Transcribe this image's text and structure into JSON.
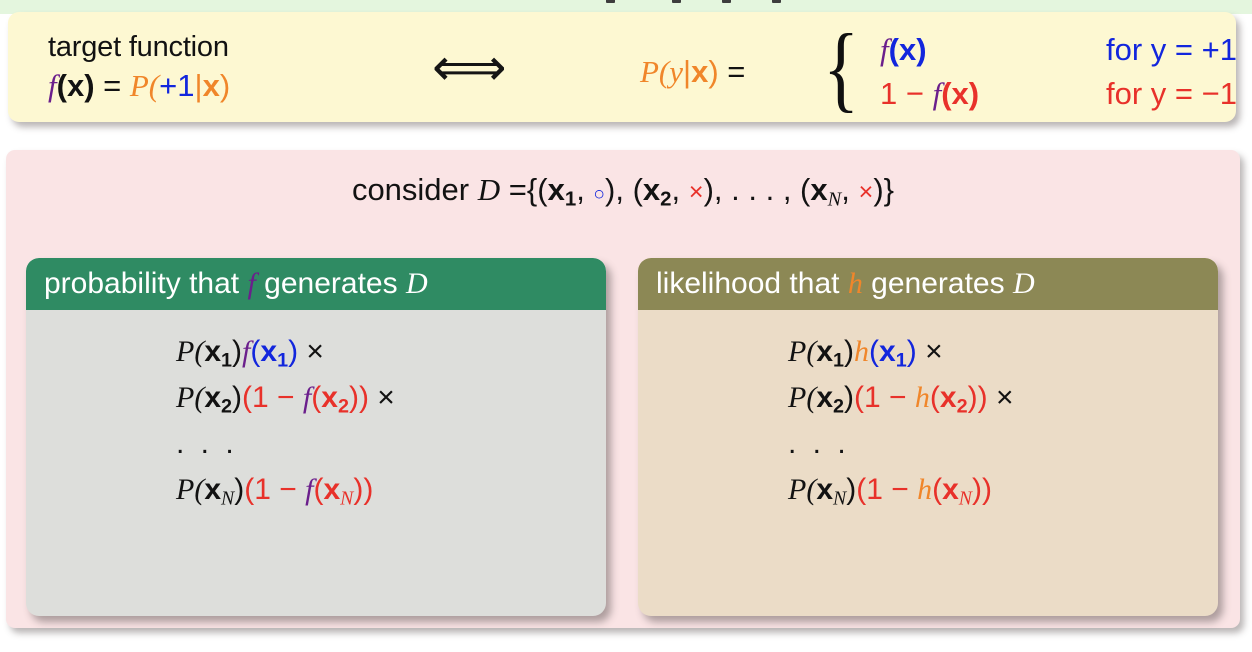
{
  "slide": {
    "background_color": "#ffffff",
    "top_strip_color": "#e4f6de"
  },
  "definition_box": {
    "background_color": "#fdf8d2",
    "left_label": "target function",
    "left_equation": {
      "f": "f",
      "arg": "(x)",
      "equals": "=",
      "P": "P(",
      "plus_one": "+1",
      "bar": "|",
      "x": "x",
      "close": ")"
    },
    "connector": "⟺",
    "right_equation": {
      "lhs_P": "P(",
      "lhs_y": "y",
      "lhs_bar": "|",
      "lhs_x": "x",
      "lhs_close": ")",
      "equals": "=",
      "brace": "{",
      "cases": [
        {
          "value_f": "f",
          "value_arg": "(x)",
          "condition": "for y = +1",
          "color": "#1226dd"
        },
        {
          "value_prefix": "1 − ",
          "value_f": "f",
          "value_arg": "(x)",
          "condition": "for y = −1",
          "color": "#e8312a"
        }
      ]
    }
  },
  "work_panel": {
    "background_color": "#fae4e5",
    "consider": {
      "lead": "consider",
      "symbol": "D",
      "equals": "=",
      "open": "{(",
      "x1": "x",
      "x1_sub": "1",
      "comma1": ", ",
      "mark_circle": "○",
      "mid1": "), (",
      "x2": "x",
      "x2_sub": "2",
      "comma2": ", ",
      "mark_cross1": "×",
      "mid2": "), . . . , (",
      "xN": "x",
      "xN_sub": "N",
      "comma3": ", ",
      "mark_cross2": "×",
      "close": ")}"
    },
    "cards": [
      {
        "id": "probability-card",
        "header_color": "#2f8b63",
        "body_color": "#dddedb",
        "header": {
          "lead": "probability that",
          "hypothesis": "f",
          "hypothesis_color": "#6b1f8c",
          "trail": "generates",
          "dataset": "D"
        },
        "lines": [
          {
            "type": "formula",
            "P": "P(",
            "x": "x",
            "sub": "1",
            "close": ")",
            "fn": "f",
            "fn_open": "(",
            "fn_x": "x",
            "fn_sub": "1",
            "fn_close": ")",
            "times": "×",
            "form": "direct"
          },
          {
            "type": "formula",
            "P": "P(",
            "x": "x",
            "sub": "2",
            "close": ")",
            "one_minus": "(1 − ",
            "fn": "f",
            "fn_open": "(",
            "fn_x": "x",
            "fn_sub": "2",
            "fn_close": "))",
            "times": "×",
            "form": "complement"
          },
          {
            "type": "dots",
            "text": ". . ."
          },
          {
            "type": "formula",
            "P": "P(",
            "x": "x",
            "sub": "N",
            "close": ")",
            "one_minus": "(1 − ",
            "fn": "f",
            "fn_open": "(",
            "fn_x": "x",
            "fn_sub": "N",
            "fn_close": "))",
            "times": "",
            "form": "complement"
          }
        ]
      },
      {
        "id": "likelihood-card",
        "header_color": "#8c8855",
        "body_color": "#ebdcc7",
        "header": {
          "lead": "likelihood that",
          "hypothesis": "h",
          "hypothesis_color": "#f0862a",
          "trail": "generates",
          "dataset": "D"
        },
        "lines": [
          {
            "type": "formula",
            "P": "P(",
            "x": "x",
            "sub": "1",
            "close": ")",
            "fn": "h",
            "fn_open": "(",
            "fn_x": "x",
            "fn_sub": "1",
            "fn_close": ")",
            "times": "×",
            "form": "direct"
          },
          {
            "type": "formula",
            "P": "P(",
            "x": "x",
            "sub": "2",
            "close": ")",
            "one_minus": "(1 − ",
            "fn": "h",
            "fn_open": "(",
            "fn_x": "x",
            "fn_sub": "2",
            "fn_close": "))",
            "times": "×",
            "form": "complement"
          },
          {
            "type": "dots",
            "text": ". . ."
          },
          {
            "type": "formula",
            "P": "P(",
            "x": "x",
            "sub": "N",
            "close": ")",
            "one_minus": "(1 − ",
            "fn": "h",
            "fn_open": "(",
            "fn_x": "x",
            "fn_sub": "N",
            "fn_close": "))",
            "times": "",
            "form": "complement"
          }
        ]
      }
    ]
  },
  "colors": {
    "target_purple": "#6b1f8c",
    "hypothesis_orange": "#f0862a",
    "positive_blue": "#1226dd",
    "negative_red": "#e8312a",
    "green_header": "#2f8b63",
    "olive_header": "#8c8855"
  }
}
